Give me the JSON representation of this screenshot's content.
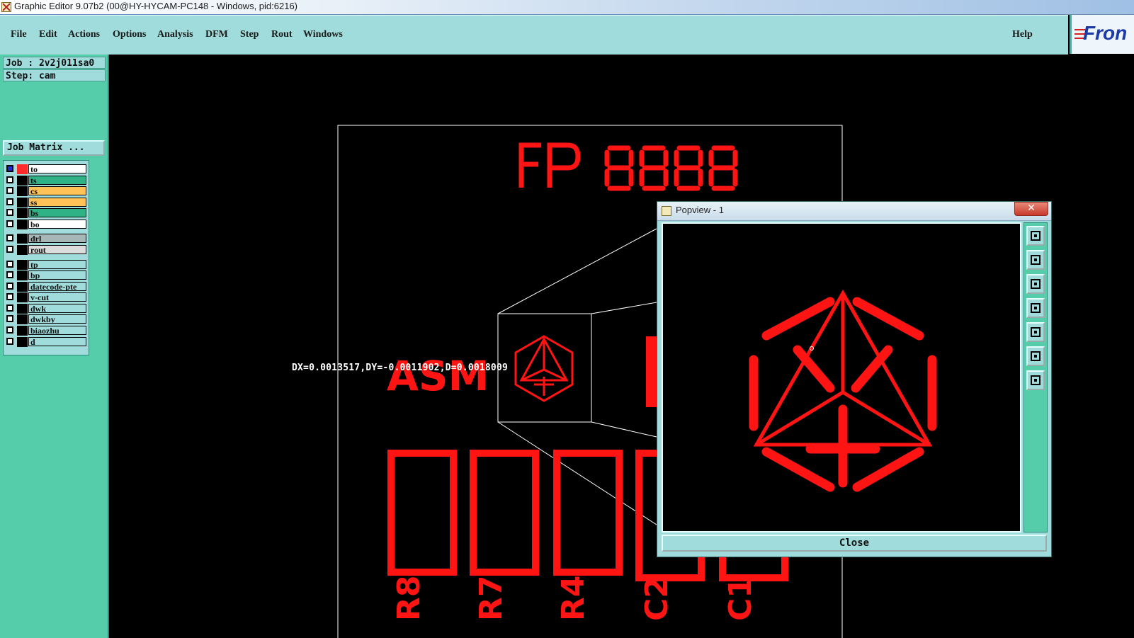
{
  "window": {
    "title": "Graphic Editor 9.07b2 (00@HY-HYCAM-PC148 - Windows, pid:6216)"
  },
  "menu": {
    "items": [
      "File",
      "Edit",
      "Actions",
      "Options",
      "Analysis",
      "DFM",
      "Step",
      "Rout",
      "Windows"
    ],
    "help": "Help"
  },
  "logo": {
    "text": "Fron"
  },
  "left_panel": {
    "job": "Job : 2v2j011sa0",
    "step": "Step: cam",
    "job_matrix_button": "Job Matrix ...",
    "layers": [
      {
        "name": "to",
        "color": "#ffffff",
        "selected": true
      },
      {
        "name": "ts",
        "color": "#2fb386"
      },
      {
        "name": "cs",
        "color": "#ffc256"
      },
      {
        "name": "ss",
        "color": "#ffc256"
      },
      {
        "name": "bs",
        "color": "#2fb386"
      },
      {
        "name": "bo",
        "color": "#ffffff"
      },
      {
        "name": "drl",
        "color": "#a7b7b8"
      },
      {
        "name": "rout",
        "color": "#dcdcdc"
      },
      {
        "name": "tp",
        "color": "#9fdcdb"
      },
      {
        "name": "bp",
        "color": "#9fdcdb"
      },
      {
        "name": "datecode-pte",
        "color": "#9fdcdb"
      },
      {
        "name": "v-cut",
        "color": "#9fdcdb"
      },
      {
        "name": "dwk",
        "color": "#9fdcdb"
      },
      {
        "name": "dwkby",
        "color": "#9fdcdb"
      },
      {
        "name": "biaozhu",
        "color": "#9fdcdb"
      },
      {
        "name": "d",
        "color": "#9fdcdb"
      }
    ]
  },
  "canvas": {
    "fp_text": "FP",
    "asm_text": "ASM",
    "measurement": "DX=0.0013517,DY=-0.0011902,D=0.0018009",
    "ref_labels": [
      "R8",
      "R7",
      "R4",
      "C2",
      "C1"
    ]
  },
  "popview": {
    "title": "Popview - 1",
    "close_x": "✕",
    "close_button": "Close",
    "tools": [
      "zoom-fit-icon",
      "pan-up-icon",
      "pan-down-icon",
      "pan-left-icon",
      "pan-right-icon",
      "zoom-out-icon",
      "zoom-in-icon"
    ]
  }
}
